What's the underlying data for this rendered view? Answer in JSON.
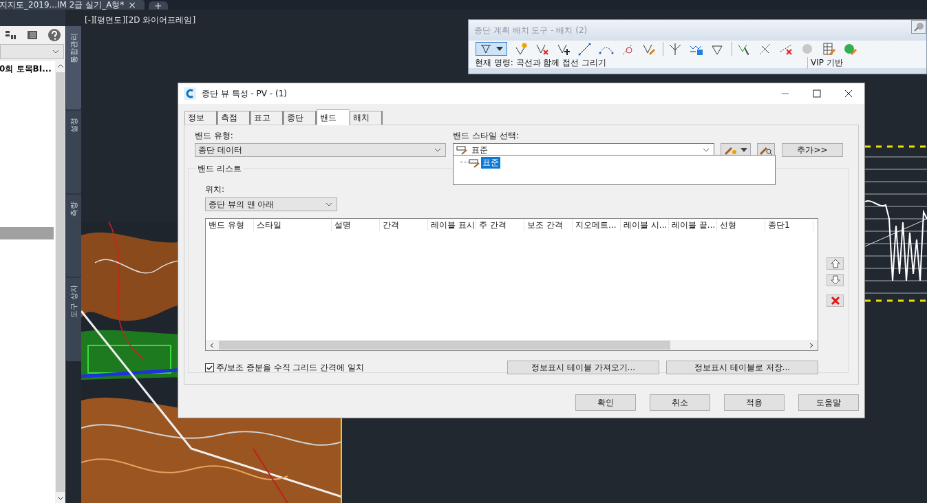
{
  "document_tab": {
    "title": "지지도_2019...IM 2급 실기_A형*",
    "close": "×",
    "add": "+"
  },
  "left_panel": {
    "items": [
      {
        "label": "0회 토목BI..."
      }
    ]
  },
  "vertical_tabs": [
    {
      "label": "통합관리",
      "selected": true
    },
    {
      "label": "설정",
      "selected": false
    },
    {
      "label": "측량",
      "selected": false
    },
    {
      "label": "도구 상자",
      "selected": false
    }
  ],
  "viewport_label": "[-][평면도][2D 와이어프레임]",
  "layout_tools": {
    "title": "종단 계획 배치 도구 - 배치 (2)",
    "command": "현재 명령: 곡선과 함께 접선 그리기",
    "mode": "VIP 기반"
  },
  "dialog": {
    "title": "종단 뷰 특성 - PV - (1)",
    "tabs": [
      {
        "label": "정보",
        "selected": false
      },
      {
        "label": "측점",
        "selected": false
      },
      {
        "label": "표고",
        "selected": false
      },
      {
        "label": "종단",
        "selected": false
      },
      {
        "label": "밴드",
        "selected": true
      },
      {
        "label": "해치",
        "selected": false
      }
    ],
    "band_type": {
      "label": "밴드 유형:",
      "value": "종단 데이터"
    },
    "band_style": {
      "label": "밴드 스타일 선택:",
      "value": "표준",
      "options": [
        {
          "label": "표준",
          "selected": true
        }
      ]
    },
    "add_button": "추가>>",
    "band_list": {
      "legend": "밴드 리스트",
      "location": {
        "label": "위치:",
        "value": "종단 뷰의 맨 아래"
      },
      "columns": [
        "밴드 유형",
        "스타일",
        "설명",
        "간격",
        "레이블 표시",
        "주 간격",
        "보조 간격",
        "지오메트...",
        "레이블 시...",
        "레이블 끝...",
        "선형",
        "종단1"
      ]
    },
    "match_grid": {
      "label": "주/보조 증분을 수직 그리드 간격에 일치",
      "checked": true
    },
    "import_button": "정보표시 테이블 가져오기...",
    "save_button": "정보표시 테이블로 저장...",
    "buttons": [
      "확인",
      "취소",
      "적용",
      "도움말"
    ]
  }
}
